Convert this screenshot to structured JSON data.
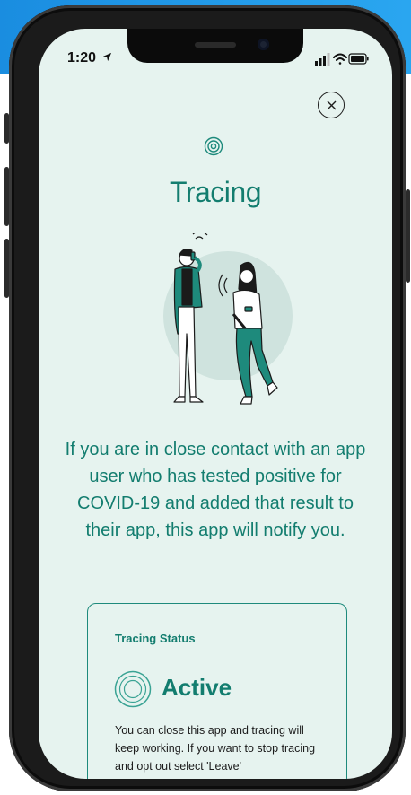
{
  "status_bar": {
    "time": "1:20"
  },
  "page": {
    "title": "Tracing",
    "description": "If you are in close contact with an app user who has tested positive for COVID-19 and added that result to their app, this app will notify you."
  },
  "card": {
    "heading": "Tracing Status",
    "status": "Active",
    "body": "You can close this app and tracing will keep working. If you want to stop tracing and opt out select 'Leave'"
  },
  "colors": {
    "accent": "#137d6f",
    "screen_background": "#e6f3ef",
    "brand_band": "#1a8de0"
  },
  "icons": [
    "location-arrow-icon",
    "signal-icon",
    "wifi-icon",
    "battery-icon",
    "close-icon",
    "tracing-icon",
    "status-ring-icon"
  ]
}
